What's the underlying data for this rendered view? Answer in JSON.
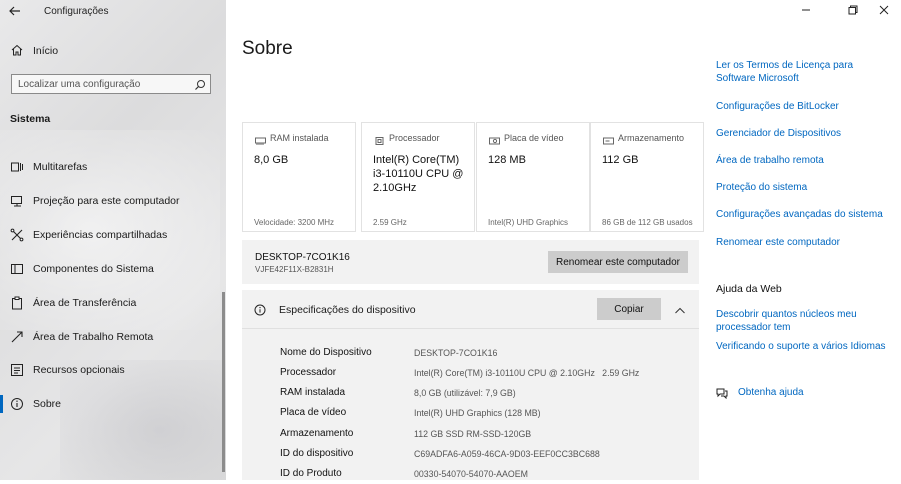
{
  "window": {
    "title": "Configurações",
    "back_icon": "back-arrow-icon",
    "controls": [
      "minimize-icon",
      "maximize-icon",
      "close-icon"
    ]
  },
  "sidebar": {
    "home_label": "Início",
    "search_placeholder": "Localizar uma configuração",
    "section_title": "Sistema",
    "items": [
      {
        "label": "Multitarefas",
        "icon": "multitask-icon"
      },
      {
        "label": "Projeção para este computador",
        "icon": "projection-icon"
      },
      {
        "label": "Experiências compartilhadas",
        "icon": "shared-experiences-icon"
      },
      {
        "label": "Componentes do Sistema",
        "icon": "system-components-icon"
      },
      {
        "label": "Área de Transferência",
        "icon": "clipboard-icon"
      },
      {
        "label": "Área de Trabalho Remota",
        "icon": "remote-desktop-icon"
      },
      {
        "label": "Recursos opcionais",
        "icon": "optional-features-icon"
      },
      {
        "label": "Sobre",
        "icon": "info-icon",
        "active": true
      }
    ]
  },
  "main": {
    "title": "Sobre",
    "cards": [
      {
        "title": "RAM instalada",
        "value": "8,0 GB",
        "footer": "Velocidade: 3200 MHz",
        "icon": "ram-icon"
      },
      {
        "title": "Processador",
        "value": "Intel(R) Core(TM) i3-10110U CPU @ 2.10GHz",
        "footer": "2.59 GHz",
        "icon": "processor-icon"
      },
      {
        "title": "Placa de vídeo",
        "value": "128 MB",
        "footer": "Intel(R) UHD Graphics",
        "icon": "graphics-card-icon"
      },
      {
        "title": "Armazenamento",
        "value": "112 GB",
        "footer": "86 GB de 112 GB usados",
        "icon": "storage-icon"
      }
    ],
    "device": {
      "name": "DESKTOP-7CO1K16",
      "id": "VJFE42F11X-B2831H",
      "rename_button": "Renomear este computador"
    },
    "specs": {
      "header": "Especificações do dispositivo",
      "copy_button": "Copiar",
      "rows": [
        {
          "key": "Nome do Dispositivo",
          "value": "DESKTOP-7CO1K16"
        },
        {
          "key": "Processador",
          "value": "Intel(R) Core(TM) i3-10110U CPU @ 2.10GHz   2.59 GHz"
        },
        {
          "key": "RAM instalada",
          "value": "8,0 GB (utilizável: 7,9 GB)"
        },
        {
          "key": "Placa de vídeo",
          "value": "Intel(R) UHD Graphics (128 MB)"
        },
        {
          "key": "Armazenamento",
          "value": "112 GB SSD RM-SSD-120GB"
        },
        {
          "key": "ID do dispositivo",
          "value": "C69ADFA6-A059-46CA-9D03-EEF0CC3BC688"
        },
        {
          "key": "ID do Produto",
          "value": "00330-54070-54070-AAOEM"
        }
      ]
    }
  },
  "related": {
    "links": [
      {
        "text": "Ler os Termos de Licença para Software Microsoft"
      },
      {
        "text": "Configurações de BitLocker"
      },
      {
        "text": "Gerenciador de Dispositivos"
      },
      {
        "text": "Área de trabalho remota"
      },
      {
        "text": "Proteção do sistema"
      },
      {
        "text": "Configurações avançadas do sistema"
      },
      {
        "text": "Renomear este computador"
      }
    ],
    "web_help_title": "Ajuda da Web",
    "web_links": [
      {
        "text": "Descobrir quantos núcleos meu processador tem"
      },
      {
        "text": "Verificando o suporte a vários Idiomas"
      }
    ],
    "get_help": "Obtenha ajuda"
  }
}
